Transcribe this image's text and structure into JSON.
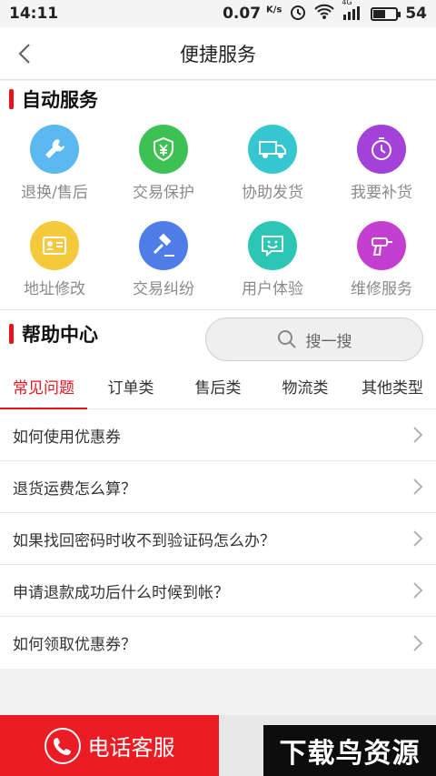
{
  "status_bar": {
    "time": "14:11",
    "speed": "0.07",
    "speed_unit": "K/s",
    "network": "4G",
    "battery": "54",
    "battery_level": 0.54
  },
  "nav": {
    "title": "便捷服务",
    "back_icon": "back-arrow-icon"
  },
  "auto_service": {
    "title": "自动服务",
    "items": [
      {
        "label": "退换/售后",
        "icon": "wrench-icon",
        "color": "#5bb8f0"
      },
      {
        "label": "交易保护",
        "icon": "shield-yen-icon",
        "color": "#3dc152"
      },
      {
        "label": "协助发货",
        "icon": "truck-icon",
        "color": "#35c7cf"
      },
      {
        "label": "我要补货",
        "icon": "clock-icon",
        "color": "#a342d9"
      },
      {
        "label": "地址修改",
        "icon": "address-card-icon",
        "color": "#f4c93c"
      },
      {
        "label": "交易纠纷",
        "icon": "gavel-icon",
        "color": "#4f7de8"
      },
      {
        "label": "用户体验",
        "icon": "smile-chat-icon",
        "color": "#2cc6b5"
      },
      {
        "label": "维修服务",
        "icon": "drill-icon",
        "color": "#c43fcf"
      }
    ]
  },
  "help_center": {
    "title": "帮助中心",
    "search_placeholder": "搜一搜",
    "tabs": [
      "常见问题",
      "订单类",
      "售后类",
      "物流类",
      "其他类型"
    ],
    "active_tab": 0,
    "faq": [
      "如何使用优惠券",
      "退货运费怎么算？",
      "如果找回密码时收不到验证码怎么办？",
      "申请退款成功后什么时候到帐？",
      "如何领取优惠券？"
    ]
  },
  "bottom": {
    "call_label": "电话客服",
    "watermark": "下载鸟资源"
  },
  "colors": {
    "accent": "#e8141c",
    "call": "#ec1c24"
  }
}
